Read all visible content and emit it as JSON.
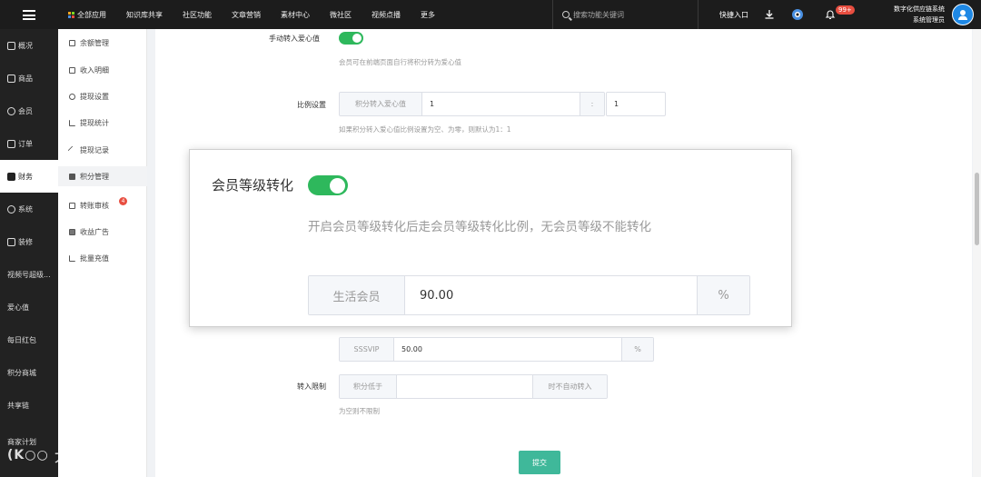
{
  "topbar": {
    "nav": [
      "全部应用",
      "知识库共享",
      "社区功能",
      "文章营销",
      "素材中心",
      "微社区",
      "视频点播",
      "更多"
    ],
    "search_placeholder": "搜索功能关键词",
    "quick_entry": "快捷入口",
    "notify_badge": "99+",
    "user_line1": "数字化供应链系统",
    "user_line2": "系统管理员",
    "colors": {
      "bar": "#1c1c1c",
      "grid": [
        "#f5a623",
        "#7ed321",
        "#4a90e2",
        "#e84e40"
      ]
    }
  },
  "sidebar": {
    "items": [
      "概况",
      "商品",
      "会员",
      "订单",
      "财务",
      "系统",
      "装修",
      "视频号超级...",
      "爱心值",
      "每日红包",
      "积分商城",
      "共享链",
      "商家计划"
    ],
    "active": "财务"
  },
  "subnav": {
    "items": [
      "余额管理",
      "收入明细",
      "提现设置",
      "提现统计",
      "提现记录",
      "积分管理",
      "转账审核",
      "收益广告",
      "批量充值"
    ],
    "active": "积分管理",
    "transfer_badge": "4"
  },
  "form": {
    "manual_label": "手动转入爱心值",
    "manual_hint": "会员可在前端页面自行将积分转为爱心值",
    "ratio_label": "比例设置",
    "ratio_addon": "积分转入爱心值",
    "ratio_left": "1",
    "ratio_colon": ":",
    "ratio_right": "1",
    "ratio_hint": "如果积分转入爱心值比例设置为空、为零，则默认为1：1",
    "level_label": "会员等级转化",
    "level_hint": "开启会员等级转化后走会员等级转化比例，无会员等级不能转化",
    "life_member": "生活会员",
    "life_value": "90.00",
    "percent": "%",
    "sssvip": "SSSVIP",
    "sssvip_value": "50.00",
    "limit_label": "转入限制",
    "limit_addon": "积分低于",
    "limit_suffix": "时不自动转入",
    "limit_hint": "为空则不限制",
    "submit": "提交"
  },
  "watermark": "大数跨境"
}
